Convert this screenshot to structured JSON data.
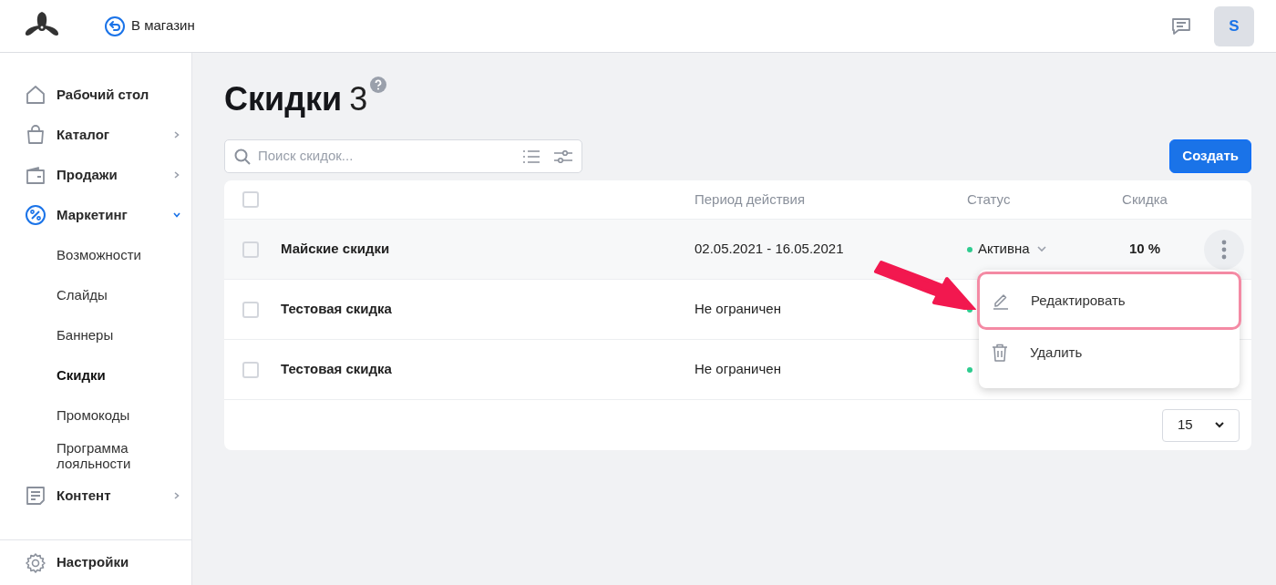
{
  "header": {
    "back_link": "В магазин",
    "avatar": "S"
  },
  "sidebar": {
    "items": [
      {
        "label": "Рабочий стол",
        "has_arrow": false,
        "selected": false
      },
      {
        "label": "Каталог",
        "has_arrow": true,
        "expanded": false,
        "selected": false
      },
      {
        "label": "Продажи",
        "has_arrow": true,
        "expanded": false,
        "selected": false
      },
      {
        "label": "Маркетинг",
        "has_arrow": true,
        "expanded": true,
        "selected": true,
        "children": [
          {
            "label": "Возможности",
            "selected": false
          },
          {
            "label": "Слайды",
            "selected": false
          },
          {
            "label": "Баннеры",
            "selected": false
          },
          {
            "label": "Скидки",
            "selected": true
          },
          {
            "label": "Промокоды",
            "selected": false
          },
          {
            "label": "Программа лояльности",
            "selected": false
          }
        ]
      },
      {
        "label": "Контент",
        "has_arrow": true,
        "expanded": false,
        "selected": false
      }
    ],
    "footer_item": "Настройки"
  },
  "page": {
    "title": "Скидки",
    "count": "3"
  },
  "search": {
    "placeholder": "Поиск скидок..."
  },
  "create_button": "Создать",
  "table": {
    "columns": {
      "period": "Период действия",
      "status": "Статус",
      "discount": "Скидка"
    },
    "select_all_checked": false,
    "rows": [
      {
        "name": "Майские скидки",
        "period": "02.05.2021 - 16.05.2021",
        "status": {
          "label": "Активна",
          "color": "#2ecc8f"
        },
        "discount": "10 %",
        "checked": false,
        "hovered": true
      },
      {
        "name": "Тестовая скидка",
        "period": "Не ограничен",
        "status": {
          "color": "#2ecc8f"
        },
        "checked": false,
        "hovered": false
      },
      {
        "name": "Тестовая скидка",
        "period": "Не ограничен",
        "status": {
          "color": "#2ecc8f"
        },
        "checked": false,
        "hovered": false
      }
    ],
    "page_size": "15"
  },
  "context_menu": {
    "items": [
      {
        "label": "Редактировать",
        "highlighted": true
      },
      {
        "label": "Удалить",
        "highlighted": false
      }
    ]
  }
}
